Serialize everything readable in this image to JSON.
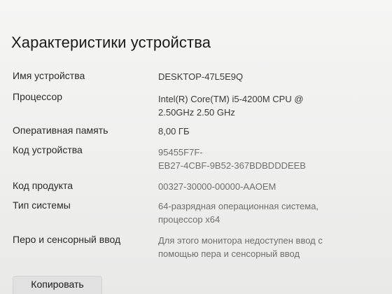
{
  "page_title": "Характеристики устройства",
  "specs": [
    {
      "label": "Имя устройства",
      "value_lines": [
        "DESKTOP-47L5E9Q"
      ]
    },
    {
      "label": "Процессор",
      "value_lines": [
        "Intel(R) Core(TM) i5-4200M CPU @",
        "2.50GHz   2.50 GHz"
      ]
    },
    {
      "label": "Оперативная память",
      "value_lines": [
        "8,00 ГБ"
      ]
    },
    {
      "label": "Код устройства",
      "value_lines": [
        "95455F7F-",
        "EB27-4CBF-9B52-367BDBDDDEEB"
      ]
    },
    {
      "label": "Код продукта",
      "value_lines": [
        "00327-30000-00000-AAOEM"
      ]
    },
    {
      "label": "Тип системы",
      "value_lines": [
        "64-разрядная операционная система,",
        "процессор x64"
      ]
    },
    {
      "label": "Перо и сенсорный ввод",
      "value_lines": [
        "Для этого монитора недоступен ввод с",
        "помощью пера и сенсорный ввод"
      ]
    }
  ],
  "copy_button_label": "Копировать"
}
